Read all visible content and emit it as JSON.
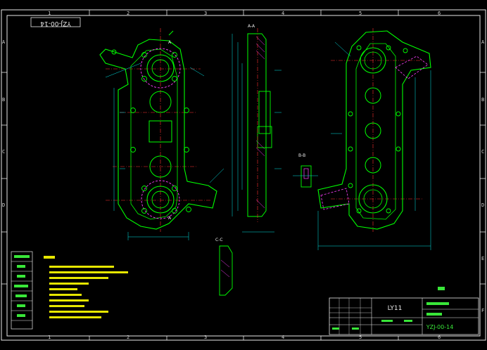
{
  "drawing": {
    "drawing_no_box": "YZJ-00-14",
    "title_block": {
      "material": "LY11",
      "part_number": "YZJ-00-14"
    },
    "sections": {
      "section_a": "A-A",
      "section_b": "B-B",
      "section_c": "C-C"
    },
    "cut_marks": [
      "A",
      "A"
    ],
    "zones_horizontal": [
      "1",
      "2",
      "3",
      "4",
      "5",
      "6"
    ],
    "zones_vertical": [
      "A",
      "B",
      "C",
      "D",
      "E",
      "F"
    ]
  },
  "colors": {
    "background": "#000000",
    "border": "#e8e8e8",
    "part_outline": "#00ff00",
    "dimensions": "#00e5e5",
    "center_lines": "#ff3030",
    "hidden_lines": "#ff40ff",
    "annotation_text": "#ffff00",
    "title_text": "#39e639"
  }
}
